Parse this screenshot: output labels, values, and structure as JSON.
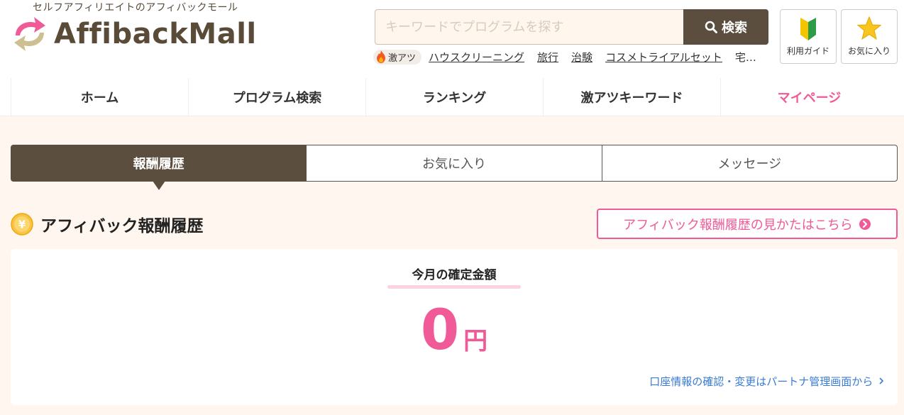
{
  "header": {
    "tagline": "セルフアフィリエイトのアフィバックモール",
    "logo_text": "AffibackMall",
    "search": {
      "placeholder": "キーワードでプログラムを探す",
      "button_label": "検索"
    },
    "hot": {
      "badge_label": "激アツ",
      "keywords": [
        "ハウスクリーニング",
        "旅行",
        "治験",
        "コスメトライアルセット"
      ],
      "more_label": "宅…"
    },
    "guide_button_label": "利用ガイド",
    "favorites_button_label": "お気に入り"
  },
  "nav": {
    "items": [
      {
        "label": "ホーム"
      },
      {
        "label": "プログラム検索"
      },
      {
        "label": "ランキング"
      },
      {
        "label": "激アツキーワード"
      },
      {
        "label": "マイページ"
      }
    ],
    "active_index": 4
  },
  "tabs": [
    {
      "label": "報酬履歴",
      "active": true
    },
    {
      "label": "お気に入り",
      "active": false
    },
    {
      "label": "メッセージ",
      "active": false
    }
  ],
  "section": {
    "title": "アフィバック報酬履歴",
    "guide_link": "アフィバック報酬履歴の見かたはこちら"
  },
  "card": {
    "label": "今月の確定金額",
    "amount": "0",
    "unit": "円",
    "account_link": "口座情報の確認・変更はパートナ管理画面から"
  },
  "colors": {
    "brand_brown": "#5c4e3e",
    "accent_pink": "#ef5a97",
    "bg_cream": "#fff7ef",
    "link_blue": "#3a7bd5"
  },
  "icons": {
    "search": "search-icon",
    "flame": "flame-icon",
    "beginner": "beginner-mark-icon",
    "star": "star-icon",
    "coin": "yen-coin-icon",
    "chevron_circle": "chevron-right-circle-icon"
  }
}
